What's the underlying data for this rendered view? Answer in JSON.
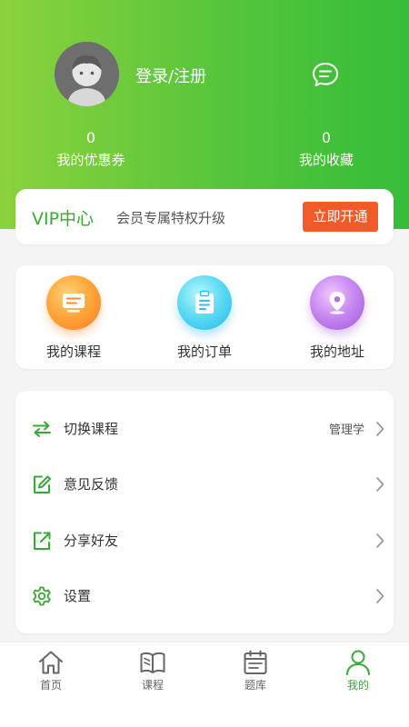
{
  "header": {
    "login_label": "登录/注册",
    "stats": [
      {
        "count": "0",
        "label": "我的优惠券"
      },
      {
        "count": "0",
        "label": "我的收藏"
      }
    ]
  },
  "vip": {
    "title": "VIP中心",
    "description": "会员专属特权升级",
    "button_label": "立即开通"
  },
  "quick_links": [
    {
      "label": "我的课程",
      "icon": "course-icon"
    },
    {
      "label": "我的订单",
      "icon": "order-icon"
    },
    {
      "label": "我的地址",
      "icon": "location-icon"
    }
  ],
  "menu": [
    {
      "label": "切换课程",
      "value": "管理学",
      "icon": "switch-icon"
    },
    {
      "label": "意见反馈",
      "icon": "feedback-icon"
    },
    {
      "label": "分享好友",
      "icon": "share-icon"
    },
    {
      "label": "设置",
      "icon": "gear-icon"
    }
  ],
  "tabs": [
    {
      "label": "首页",
      "icon": "home-icon"
    },
    {
      "label": "课程",
      "icon": "book-icon"
    },
    {
      "label": "题库",
      "icon": "calendar-icon"
    },
    {
      "label": "我的",
      "icon": "user-icon",
      "active": true
    }
  ],
  "colors": {
    "accent_green": "#3aa836",
    "header_gradient_start": "#8bd23d",
    "header_gradient_end": "#35bd3a",
    "vip_button": "#f35a2a"
  }
}
